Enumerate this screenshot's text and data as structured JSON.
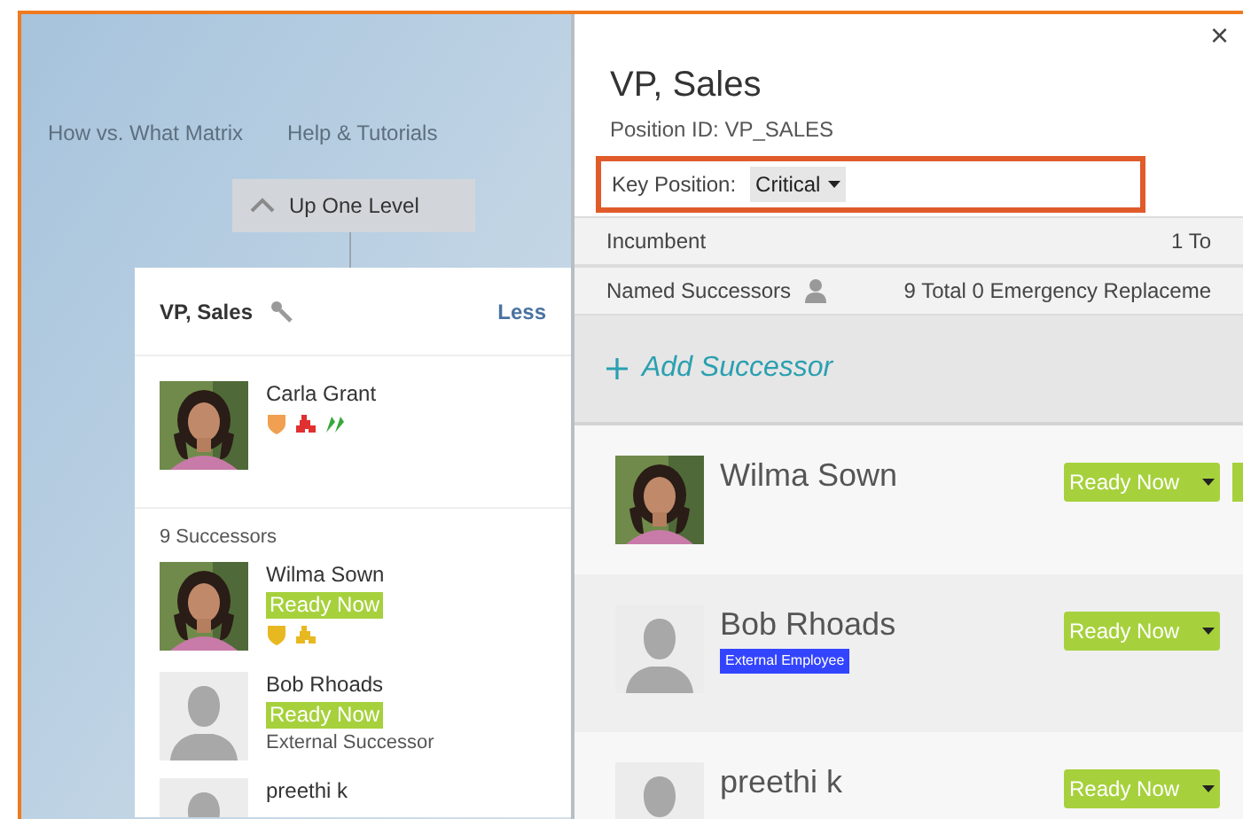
{
  "nav_links": [
    {
      "label": "How vs. What Matrix"
    },
    {
      "label": "Help & Tutorials"
    }
  ],
  "up_button": "Up One Level",
  "card": {
    "title": "VP, Sales",
    "toggle": "Less",
    "incumbent": {
      "name": "Carla Grant",
      "badges": [
        {
          "kind": "shield",
          "color": "#f0a050"
        },
        {
          "kind": "puzzle",
          "color": "#e03030"
        },
        {
          "kind": "arrows",
          "color": "#38a838"
        }
      ]
    },
    "successor_count": "9 Successors",
    "successors": [
      {
        "name": "Wilma Sown",
        "readiness": "Ready Now",
        "badges": [
          {
            "kind": "shield",
            "color": "#e8b820"
          },
          {
            "kind": "puzzle",
            "color": "#e8b820"
          }
        ]
      },
      {
        "name": "Bob Rhoads",
        "kind": "silhouette",
        "readiness": "Ready Now",
        "note": "External Successor"
      },
      {
        "name": "preethi k",
        "kind": "silhouette"
      }
    ]
  },
  "detail": {
    "close": "×",
    "title": "VP, Sales",
    "position_id": "Position ID: VP_SALES",
    "key_position": {
      "label": "Key Position:",
      "value": "Critical"
    },
    "summary_rows": [
      {
        "label": "Incumbent",
        "summary": "1 To",
        "icon": false
      },
      {
        "label": "Named Successors",
        "summary": "9 Total 0 Emergency Replaceme",
        "icon": true
      }
    ],
    "add_button": "Add Successor",
    "successors": [
      {
        "name": "Wilma Sown",
        "readiness": "Ready Now",
        "extra_dropdown": true
      },
      {
        "name": "Bob Rhoads",
        "kind": "silhouette",
        "readiness": "Ready Now",
        "tag": "External Employee"
      },
      {
        "name": "preethi k",
        "kind": "silhouette",
        "readiness": "Ready Now"
      }
    ]
  }
}
